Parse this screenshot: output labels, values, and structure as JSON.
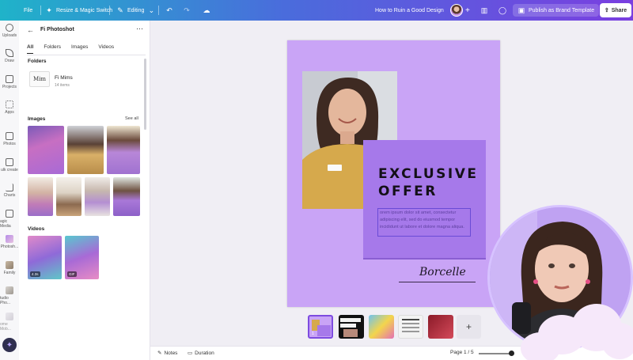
{
  "topbar": {
    "file": "File",
    "resize": "Resize & Magic Switch",
    "editing": "Editing",
    "doc_title": "How to Ruin a Good Design",
    "publish": "Publish as Brand Template",
    "share": "Share"
  },
  "rail": {
    "items": [
      {
        "label": "Uploads",
        "icon": "cloud-upload-icon"
      },
      {
        "label": "Draw",
        "icon": "pen-icon"
      },
      {
        "label": "Projects",
        "icon": "folder-icon"
      },
      {
        "label": "Apps",
        "icon": "apps-icon"
      },
      {
        "label": "Photos",
        "icon": "photo-icon"
      },
      {
        "label": "ulk create",
        "icon": "bulk-create-icon"
      },
      {
        "label": "Charts",
        "icon": "chart-icon"
      },
      {
        "label": "agic Media",
        "icon": "magic-media-icon"
      },
      {
        "label": "Photosh...",
        "icon": "folder-thumb-icon"
      },
      {
        "label": "Family",
        "icon": "folder-thumb-icon"
      },
      {
        "label": "tudio Pho...",
        "icon": "folder-thumb-icon"
      },
      {
        "label": "ome Mob...",
        "icon": "folder-thumb-icon"
      }
    ]
  },
  "panel": {
    "title": "Fi Photoshot",
    "tabs": [
      "All",
      "Folders",
      "Images",
      "Videos"
    ],
    "folders_heading": "Folders",
    "folder": {
      "thumb_text": "Mim",
      "name": "Fi Mims",
      "count": "14 items"
    },
    "images_heading": "Images",
    "see_all": "See all",
    "videos_heading": "Videos",
    "videos": [
      {
        "duration": "4.3s"
      },
      {
        "duration": "GIF"
      }
    ]
  },
  "canvas": {
    "offer_line1": "EXCLUSIVE",
    "offer_line2": "OFFER",
    "lorem": "orem ipsum dolor sit amet, consectetur adipiscing elit, sed do eiusmod tempor incididunt ut labore et dolore magna aliqua.",
    "signature": "Borcelle"
  },
  "bottombar": {
    "notes": "Notes",
    "duration": "Duration",
    "page": "Page 1 / 5",
    "active_page_number": "1"
  },
  "colors": {
    "page_bg": "#c9a4f6",
    "offer_box": "#a679ea",
    "topbar_gradient": [
      "#1fb3c9",
      "#4a6cdc",
      "#7a3fe0"
    ]
  }
}
